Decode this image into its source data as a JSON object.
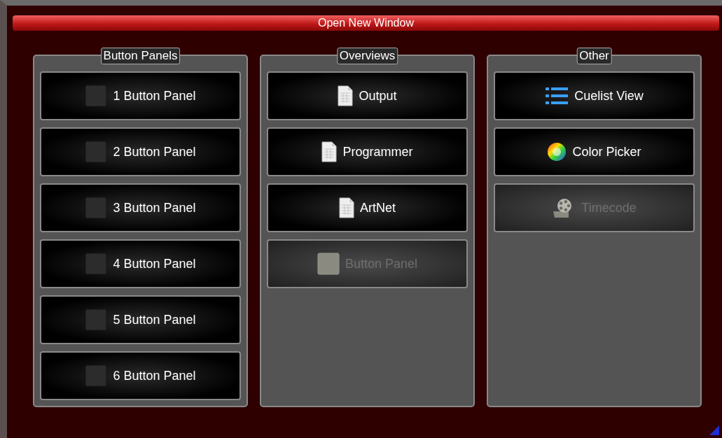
{
  "window": {
    "title": "Open New Window"
  },
  "groups": [
    {
      "title": "Button Panels",
      "items": [
        {
          "label": "1 Button Panel",
          "kind": "square",
          "disabled": false
        },
        {
          "label": "2 Button Panel",
          "kind": "square",
          "disabled": false
        },
        {
          "label": "3 Button Panel",
          "kind": "square",
          "disabled": false
        },
        {
          "label": "4 Button Panel",
          "kind": "square",
          "disabled": false
        },
        {
          "label": "5 Button Panel",
          "kind": "square",
          "disabled": false
        },
        {
          "label": "6 Button Panel",
          "kind": "square",
          "disabled": false
        }
      ]
    },
    {
      "title": "Overviews",
      "items": [
        {
          "label": "Output",
          "kind": "document",
          "disabled": false
        },
        {
          "label": "Programmer",
          "kind": "document",
          "disabled": false
        },
        {
          "label": "ArtNet",
          "kind": "document",
          "disabled": false
        },
        {
          "label": "Button Panel",
          "kind": "square",
          "disabled": true
        }
      ]
    },
    {
      "title": "Other",
      "items": [
        {
          "label": "Cuelist View",
          "kind": "list",
          "disabled": false
        },
        {
          "label": "Color Picker",
          "kind": "palette",
          "disabled": false
        },
        {
          "label": "Timecode",
          "kind": "reel",
          "disabled": true
        }
      ]
    }
  ]
}
